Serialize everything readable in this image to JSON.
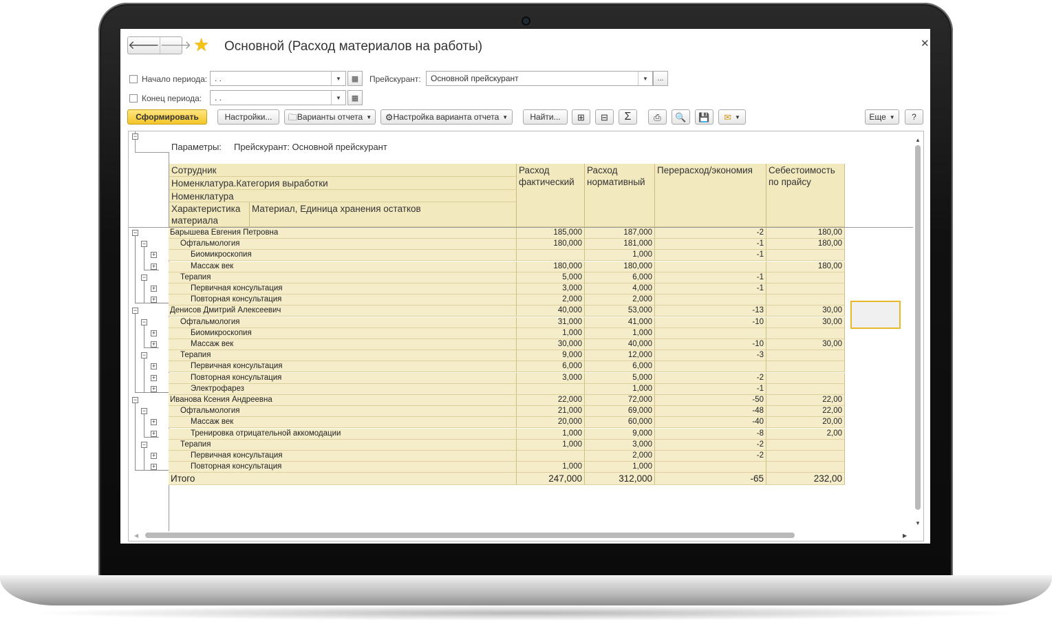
{
  "window": {
    "title": "Основной (Расход материалов на работы)",
    "close_icon": "close-icon",
    "nav": {
      "back_icon": "arrow-left-icon",
      "back_glyph": "🡐",
      "forward_icon": "arrow-right-icon",
      "forward_glyph": "🡒"
    },
    "favorite_icon": "star-icon"
  },
  "filters": {
    "period_start": {
      "label": "Начало периода:",
      "value": " .  ."
    },
    "period_end": {
      "label": "Конец периода:",
      "value": " .  ."
    },
    "pricelist": {
      "label": "Прейскурант:",
      "value": "Основной прейскурант",
      "select_label": "..."
    }
  },
  "toolbar": {
    "generate": "Сформировать",
    "settings": "Настройки...",
    "variants": "Варианты отчета",
    "variant_settings": "Настройка варианта отчета",
    "find": "Найти...",
    "more": "Еще",
    "help": "?"
  },
  "colors": {
    "accent": "#f3c52a",
    "header_bg": "#f3e9bf",
    "row_bg": "#f5edca",
    "selection": "#e8b82b"
  },
  "report": {
    "params_label": "Параметры:",
    "params_value": "Прейскурант: Основной прейскурант",
    "headers": {
      "employee": "Сотрудник",
      "category": "Номенклатура.Категория выработки",
      "nomenclature": "Номенклатура",
      "characteristic": "Характеристика материала",
      "material_unit": "Материал, Единица хранения остатков",
      "actual": "Расход фактический",
      "normative": "Расход нормативный",
      "overrun": "Перерасход/экономия",
      "cost": "Себестоимость по прайсу"
    },
    "rows": [
      {
        "name": "Барышева Евгения Петровна",
        "level": 0,
        "actual": "185,000",
        "norm": "187,000",
        "diff": "-2",
        "cost": "180,00"
      },
      {
        "name": "Офтальмология",
        "level": 1,
        "actual": "180,000",
        "norm": "181,000",
        "diff": "-1",
        "cost": "180,00"
      },
      {
        "name": "Биомикроскопия",
        "level": 2,
        "actual": "",
        "norm": "1,000",
        "diff": "-1",
        "cost": ""
      },
      {
        "name": "Массаж век",
        "level": 2,
        "actual": "180,000",
        "norm": "180,000",
        "diff": "",
        "cost": "180,00"
      },
      {
        "name": "Терапия",
        "level": 1,
        "actual": "5,000",
        "norm": "6,000",
        "diff": "-1",
        "cost": ""
      },
      {
        "name": "Первичная консультация",
        "level": 2,
        "actual": "3,000",
        "norm": "4,000",
        "diff": "-1",
        "cost": ""
      },
      {
        "name": "Повторная консультация",
        "level": 2,
        "actual": "2,000",
        "norm": "2,000",
        "diff": "",
        "cost": ""
      },
      {
        "name": "Денисов Дмитрий Алексеевич",
        "level": 0,
        "actual": "40,000",
        "norm": "53,000",
        "diff": "-13",
        "cost": "30,00"
      },
      {
        "name": "Офтальмология",
        "level": 1,
        "actual": "31,000",
        "norm": "41,000",
        "diff": "-10",
        "cost": "30,00"
      },
      {
        "name": "Биомикроскопия",
        "level": 2,
        "actual": "1,000",
        "norm": "1,000",
        "diff": "",
        "cost": ""
      },
      {
        "name": "Массаж век",
        "level": 2,
        "actual": "30,000",
        "norm": "40,000",
        "diff": "-10",
        "cost": "30,00"
      },
      {
        "name": "Терапия",
        "level": 1,
        "actual": "9,000",
        "norm": "12,000",
        "diff": "-3",
        "cost": ""
      },
      {
        "name": "Первичная консультация",
        "level": 2,
        "actual": "6,000",
        "norm": "6,000",
        "diff": "",
        "cost": ""
      },
      {
        "name": "Повторная консультация",
        "level": 2,
        "actual": "3,000",
        "norm": "5,000",
        "diff": "-2",
        "cost": ""
      },
      {
        "name": "Электрофарез",
        "level": 2,
        "actual": "",
        "norm": "1,000",
        "diff": "-1",
        "cost": ""
      },
      {
        "name": "Иванова Ксения Андреевна",
        "level": 0,
        "actual": "22,000",
        "norm": "72,000",
        "diff": "-50",
        "cost": "22,00"
      },
      {
        "name": "Офтальмология",
        "level": 1,
        "actual": "21,000",
        "norm": "69,000",
        "diff": "-48",
        "cost": "22,00"
      },
      {
        "name": "Массаж век",
        "level": 2,
        "actual": "20,000",
        "norm": "60,000",
        "diff": "-40",
        "cost": "20,00"
      },
      {
        "name": "Тренировка отрицательной аккомодации",
        "level": 2,
        "actual": "1,000",
        "norm": "9,000",
        "diff": "-8",
        "cost": "2,00"
      },
      {
        "name": "Терапия",
        "level": 1,
        "actual": "1,000",
        "norm": "3,000",
        "diff": "-2",
        "cost": ""
      },
      {
        "name": "Первичная консультация",
        "level": 2,
        "actual": "",
        "norm": "2,000",
        "diff": "-2",
        "cost": ""
      },
      {
        "name": "Повторная консультация",
        "level": 2,
        "actual": "1,000",
        "norm": "1,000",
        "diff": "",
        "cost": ""
      }
    ],
    "total": {
      "name": "Итого",
      "actual": "247,000",
      "norm": "312,000",
      "diff": "-65",
      "cost": "232,00"
    }
  }
}
